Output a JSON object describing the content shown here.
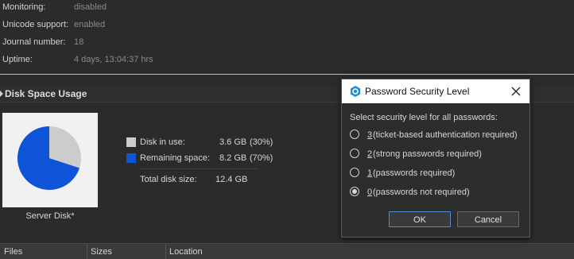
{
  "info": [
    {
      "label": "Monitoring:",
      "value": "disabled"
    },
    {
      "label": "Unicode support:",
      "value": "enabled"
    },
    {
      "label": "Journal number:",
      "value": "18"
    },
    {
      "label": "Uptime:",
      "value": "4 days, 13:04:37 hrs"
    }
  ],
  "disk_section": {
    "title": "Disk Space Usage",
    "disk_caption": "Server Disk*",
    "legend": [
      {
        "label": "Disk in use:",
        "value": "3.6 GB",
        "pct": "(30%)",
        "color": "#cccccc"
      },
      {
        "label": "Remaining space:",
        "value": "8.2 GB",
        "pct": "(70%)",
        "color": "#0f54d8"
      }
    ],
    "total": {
      "label": "Total disk size:",
      "value": "12.4 GB"
    },
    "usage_fraction": 0.3
  },
  "table": {
    "columns": [
      "Files",
      "Sizes",
      "Location"
    ]
  },
  "dialog": {
    "title": "Password Security Level",
    "prompt": "Select security level for all passwords:",
    "options": [
      {
        "num": "3",
        "text": " (ticket-based authentication required)",
        "checked": false
      },
      {
        "num": "2",
        "text": " (strong passwords required)",
        "checked": false
      },
      {
        "num": "1",
        "text": " (passwords required)",
        "checked": false
      },
      {
        "num": "0",
        "text": " (passwords not required)",
        "checked": true
      }
    ],
    "ok_label": "OK",
    "cancel_label": "Cancel",
    "accent_color": "#0f54d8"
  }
}
